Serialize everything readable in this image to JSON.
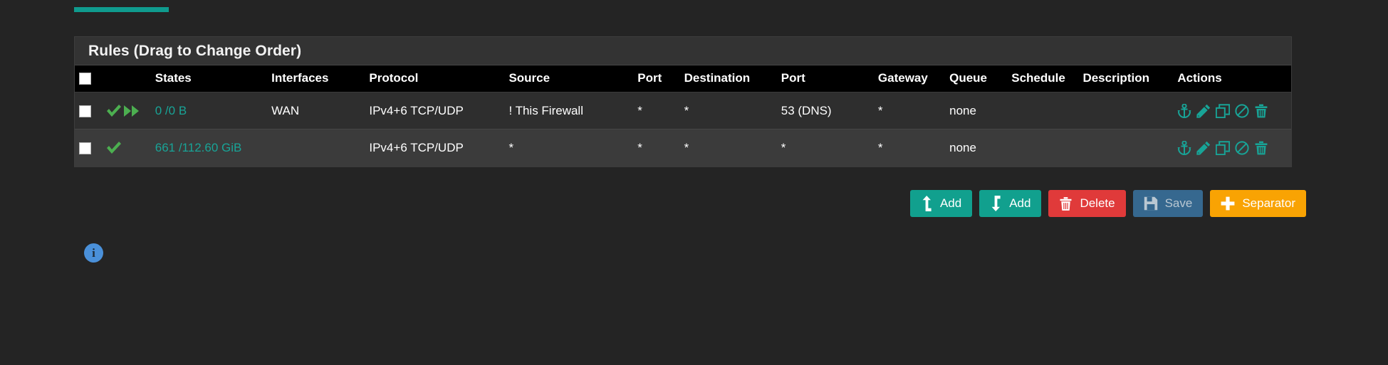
{
  "theme": {
    "background": "#242424",
    "panel_bg": "#2e2e2e",
    "panel_header_bg": "#333333",
    "table_header_bg": "#000000",
    "row_alt_bg": "#3b3b3b",
    "accent_teal": "#18a497",
    "accent_green": "#4caf50",
    "accent_red": "#e03a3a",
    "accent_blue": "#36688f",
    "accent_orange": "#f9a303",
    "info_blue": "#4a90d9"
  },
  "panel": {
    "title": "Rules (Drag to Change Order)"
  },
  "table": {
    "columns": [
      {
        "key": "check",
        "label": ""
      },
      {
        "key": "icons",
        "label": ""
      },
      {
        "key": "states",
        "label": "States"
      },
      {
        "key": "interfaces",
        "label": "Interfaces"
      },
      {
        "key": "protocol",
        "label": "Protocol"
      },
      {
        "key": "source",
        "label": "Source"
      },
      {
        "key": "src_port",
        "label": "Port"
      },
      {
        "key": "destination",
        "label": "Destination"
      },
      {
        "key": "dst_port",
        "label": "Port"
      },
      {
        "key": "gateway",
        "label": "Gateway"
      },
      {
        "key": "queue",
        "label": "Queue"
      },
      {
        "key": "schedule",
        "label": "Schedule"
      },
      {
        "key": "description",
        "label": "Description"
      },
      {
        "key": "actions",
        "label": "Actions"
      }
    ],
    "rows": [
      {
        "checked": false,
        "status_icons": [
          "check-icon",
          "fast-forward-icon"
        ],
        "states": "0 /0 B",
        "interfaces": "WAN",
        "protocol": "IPv4+6 TCP/UDP",
        "source": "! This Firewall",
        "src_port": "*",
        "destination": "*",
        "dst_port": "53 (DNS)",
        "gateway": "*",
        "queue": "none",
        "schedule": "",
        "description": "",
        "actions": [
          "anchor-icon",
          "pencil-icon",
          "copy-icon",
          "ban-icon",
          "trash-icon"
        ]
      },
      {
        "checked": false,
        "status_icons": [
          "check-icon"
        ],
        "states": "661 /112.60 GiB",
        "interfaces": "",
        "protocol": "IPv4+6 TCP/UDP",
        "source": "*",
        "src_port": "*",
        "destination": "*",
        "dst_port": "*",
        "gateway": "*",
        "queue": "none",
        "schedule": "",
        "description": "",
        "actions": [
          "anchor-icon",
          "pencil-icon",
          "copy-icon",
          "ban-icon",
          "trash-icon"
        ]
      }
    ]
  },
  "buttons": [
    {
      "name": "add-up-button",
      "label": "Add",
      "icon": "arrow-up-icon",
      "style": "btn-teal"
    },
    {
      "name": "add-down-button",
      "label": "Add",
      "icon": "arrow-down-icon",
      "style": "btn-teal"
    },
    {
      "name": "delete-button",
      "label": "Delete",
      "icon": "trash-icon",
      "style": "btn-red"
    },
    {
      "name": "save-button",
      "label": "Save",
      "icon": "floppy-icon",
      "style": "btn-blue"
    },
    {
      "name": "separator-button",
      "label": "Separator",
      "icon": "plus-icon",
      "style": "btn-orange"
    }
  ],
  "info": {
    "glyph": "i",
    "name": "info-icon"
  }
}
